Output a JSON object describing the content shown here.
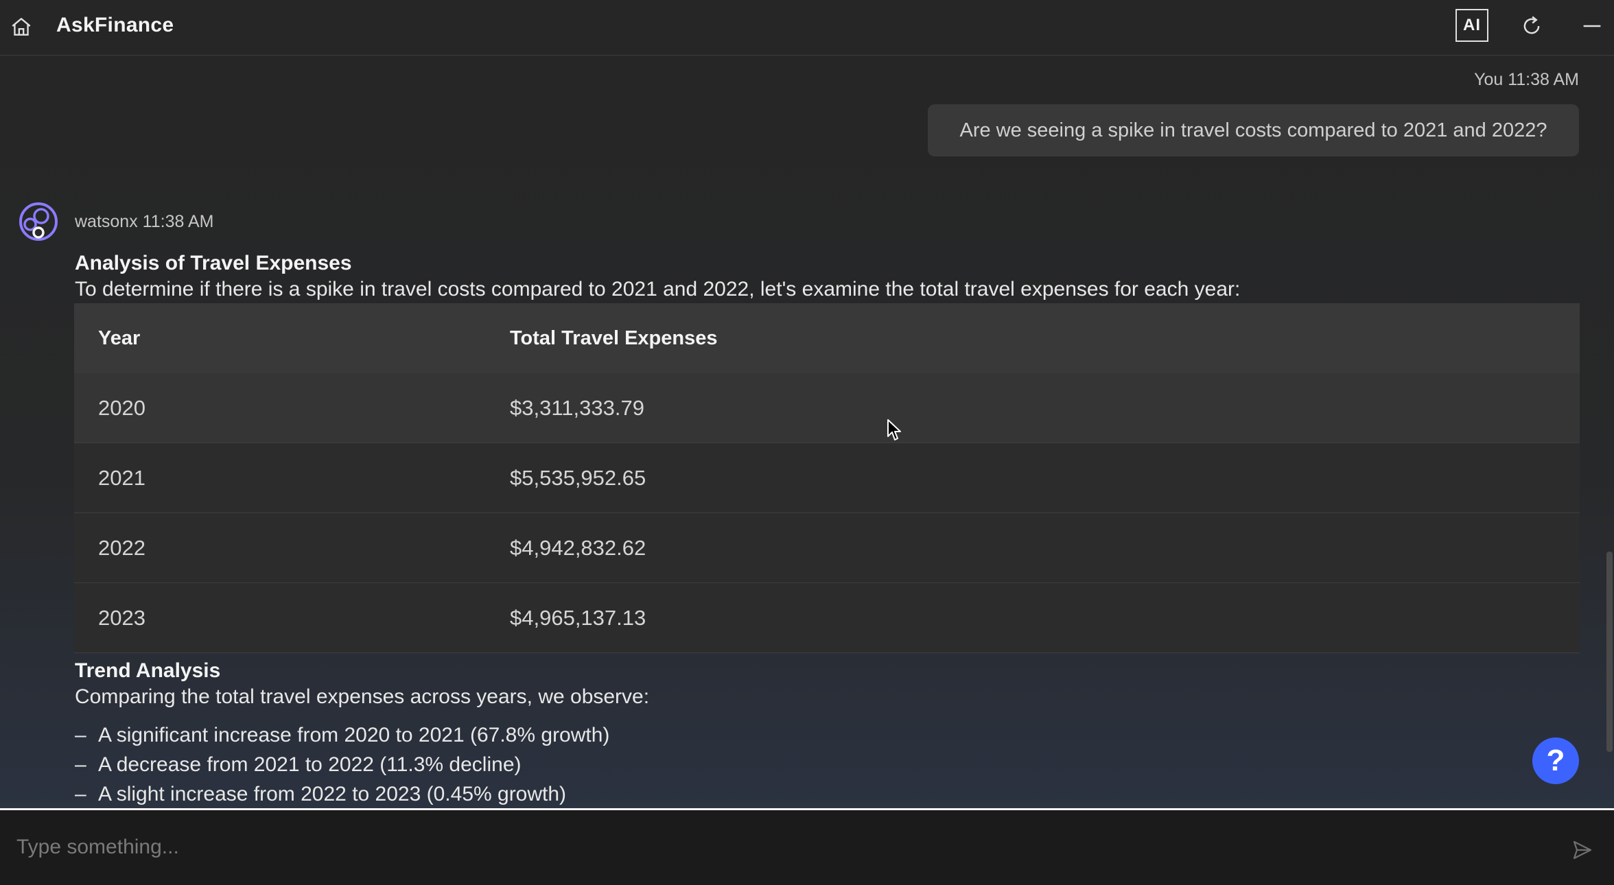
{
  "header": {
    "title": "AskFinance",
    "ai_label": "AI"
  },
  "conversation": {
    "user_message": {
      "sender": "You",
      "time": "11:38 AM",
      "text": "Are we seeing a spike in travel costs compared to 2021 and 2022?"
    },
    "bot_message": {
      "sender": "watsonx",
      "time": "11:38 AM",
      "heading": "Analysis of Travel Expenses",
      "intro": "To determine if there is a spike in travel costs compared to 2021 and 2022, let's examine the total travel expenses for each year:",
      "table": {
        "columns": [
          "Year",
          "Total Travel Expenses"
        ],
        "rows": [
          {
            "year": "2020",
            "total": "$3,311,333.79"
          },
          {
            "year": "2021",
            "total": "$5,535,952.65"
          },
          {
            "year": "2022",
            "total": "$4,942,832.62"
          },
          {
            "year": "2023",
            "total": "$4,965,137.13"
          }
        ]
      },
      "trend_heading": "Trend Analysis",
      "trend_intro": "Comparing the total travel expenses across years, we observe:",
      "bullets": [
        "A significant increase from 2020 to 2021 (67.8% growth)",
        "A decrease from 2021 to 2022 (11.3% decline)",
        "A slight increase from 2022 to 2023 (0.45% growth)"
      ],
      "bullet_marker": "–"
    }
  },
  "help": {
    "label": "?"
  },
  "composer": {
    "placeholder": "Type something..."
  },
  "colors": {
    "background": "#262626",
    "bubble": "#393939",
    "accent": "#3d63ff",
    "avatar": "#8a7cff"
  },
  "icons": [
    "home-icon",
    "refresh-icon",
    "minimize-icon",
    "send-icon",
    "watsonx-avatar-icon",
    "help-icon"
  ]
}
